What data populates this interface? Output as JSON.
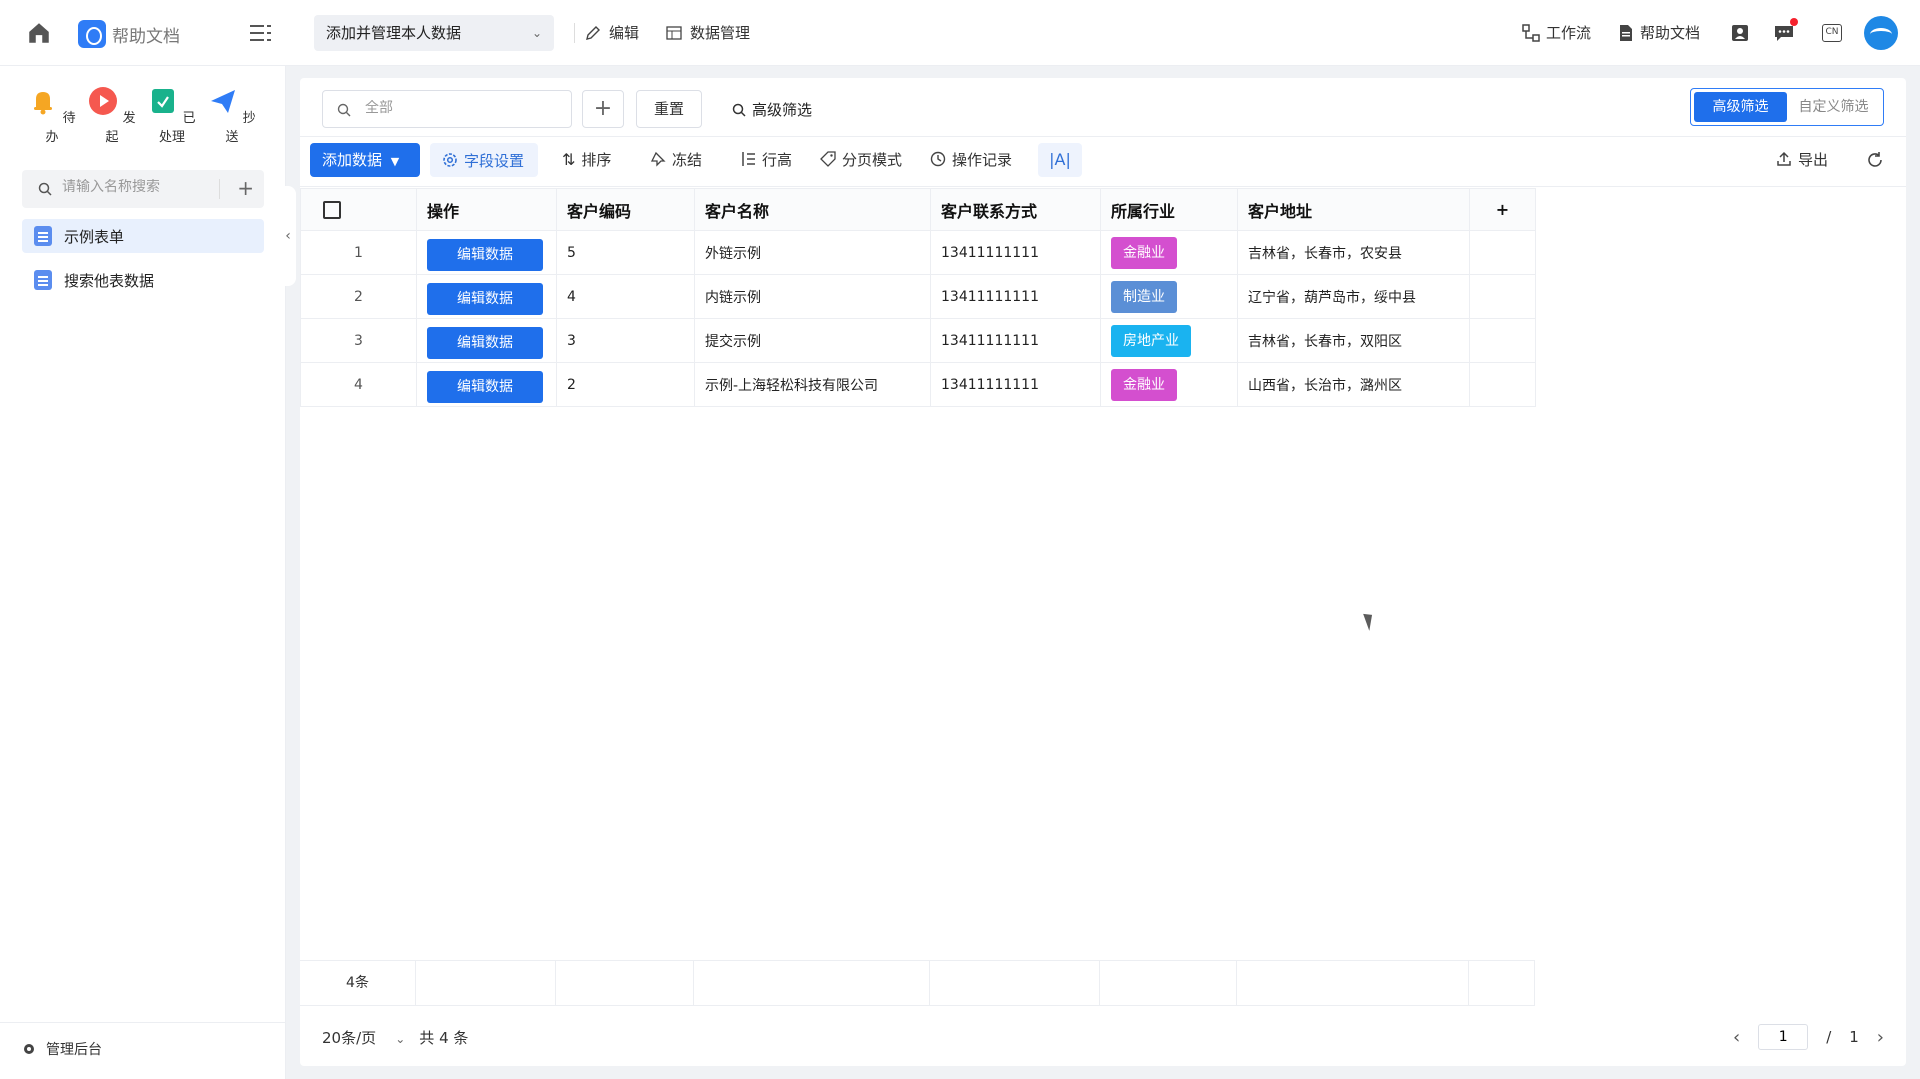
{
  "topbar": {
    "app_title": "帮助文档",
    "page_select": "添加并管理本人数据",
    "edit_label": "编辑",
    "data_mgmt_label": "数据管理",
    "workflow_label": "工作流",
    "help_docs_label": "帮助文档",
    "lang_badge": "CN"
  },
  "sidebar": {
    "quick": [
      {
        "label": "待办",
        "icon": "bell-icon",
        "color": "#f5a623"
      },
      {
        "label": "发起",
        "icon": "play-icon",
        "color": "#f5584f"
      },
      {
        "label": "已处理",
        "icon": "check-board-icon",
        "color": "#19b28c"
      },
      {
        "label": "抄送",
        "icon": "paper-plane-icon",
        "color": "#2f7cf6"
      }
    ],
    "search_placeholder": "请输入名称搜索",
    "items": [
      {
        "label": "示例表单"
      },
      {
        "label": "搜索他表数据"
      }
    ],
    "admin_label": "管理后台"
  },
  "filter": {
    "search_placeholder": "全部",
    "reset_label": "重置",
    "advanced_link": "高级筛选",
    "seg_advanced": "高级筛选",
    "seg_custom": "自定义筛选"
  },
  "toolbar": {
    "add_data": "添加数据",
    "field_settings": "字段设置",
    "sort": "排序",
    "freeze": "冻结",
    "row_height": "行高",
    "page_mode": "分页模式",
    "op_log": "操作记录",
    "font_toggle": "|A|",
    "export": "导出"
  },
  "table": {
    "columns": [
      "操作",
      "客户编码",
      "客户名称",
      "客户联系方式",
      "所属行业",
      "客户地址"
    ],
    "edit_label": "编辑数据",
    "rows": [
      {
        "num": "1",
        "code": "5",
        "name": "外链示例",
        "phone": "13411111111",
        "industry": "金融业",
        "industry_color": "#d44fcf",
        "address": "吉林省，长春市，农安县"
      },
      {
        "num": "2",
        "code": "4",
        "name": "内链示例",
        "phone": "13411111111",
        "industry": "制造业",
        "industry_color": "#5b8fd6",
        "address": "辽宁省，葫芦岛市，绥中县"
      },
      {
        "num": "3",
        "code": "3",
        "name": "提交示例",
        "phone": "13411111111",
        "industry": "房地产业",
        "industry_color": "#1ab3f0",
        "address": "吉林省，长春市，双阳区"
      },
      {
        "num": "4",
        "code": "2",
        "name": "示例-上海轻松科技有限公司",
        "phone": "13411111111",
        "industry": "金融业",
        "industry_color": "#d44fcf",
        "address": "山西省，长治市，潞州区"
      }
    ],
    "footer_count": "4条"
  },
  "pager": {
    "page_size": "20条/页",
    "total": "共 4 条",
    "current": "1",
    "separator": "/",
    "pages": "1"
  }
}
